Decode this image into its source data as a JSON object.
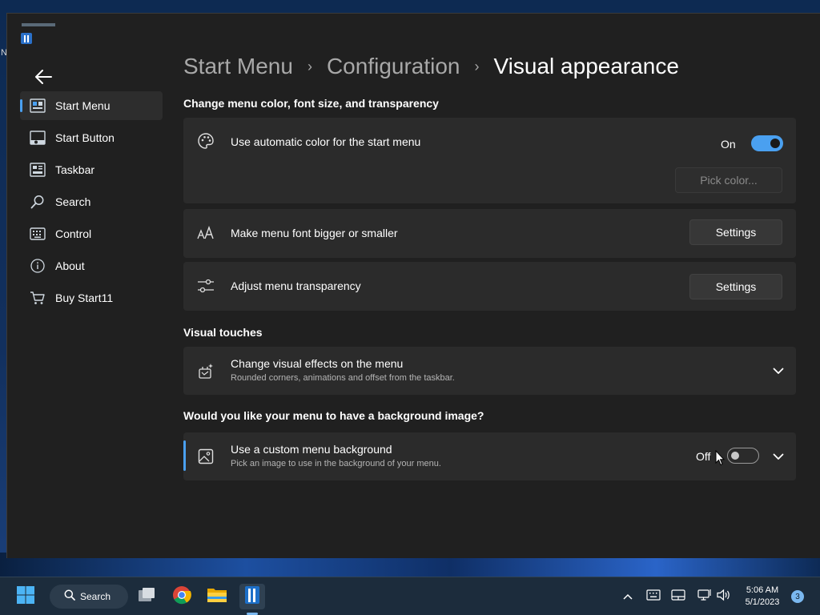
{
  "desktop": {
    "edge_label": "N"
  },
  "breadcrumb": {
    "items": [
      "Start Menu",
      "Configuration"
    ],
    "current": "Visual appearance"
  },
  "sidebar": {
    "items": [
      {
        "label": "Start Menu",
        "icon": "start-menu-icon",
        "active": true
      },
      {
        "label": "Start Button",
        "icon": "start-button-icon"
      },
      {
        "label": "Taskbar",
        "icon": "taskbar-icon"
      },
      {
        "label": "Search",
        "icon": "search-icon"
      },
      {
        "label": "Control",
        "icon": "keyboard-icon"
      },
      {
        "label": "About",
        "icon": "info-icon"
      },
      {
        "label": "Buy Start11",
        "icon": "cart-icon"
      }
    ]
  },
  "sections": {
    "color": {
      "title": "Change menu color, font size, and transparency",
      "auto_color": {
        "label": "Use automatic color for the start menu",
        "toggle_label": "On",
        "pick_color_label": "Pick color..."
      },
      "font": {
        "label": "Make menu font bigger or smaller",
        "button_label": "Settings"
      },
      "transparency": {
        "label": "Adjust menu transparency",
        "button_label": "Settings"
      }
    },
    "visual_touches": {
      "title": "Visual touches",
      "effects": {
        "label": "Change visual effects on the menu",
        "subtitle": "Rounded corners, animations and offset from the taskbar."
      }
    },
    "background": {
      "title": "Would you like your menu to have a background image?",
      "custom": {
        "label": "Use a custom menu background",
        "subtitle": "Pick an image to use in the background of your menu.",
        "toggle_label": "Off"
      }
    }
  },
  "taskbar": {
    "search_label": "Search",
    "clock_time": "5:06 AM",
    "clock_date": "5/1/2023",
    "notification_count": "3"
  },
  "colors": {
    "accent": "#4aa0f0",
    "window_bg": "#202020",
    "card_bg": "#2b2b2b"
  }
}
